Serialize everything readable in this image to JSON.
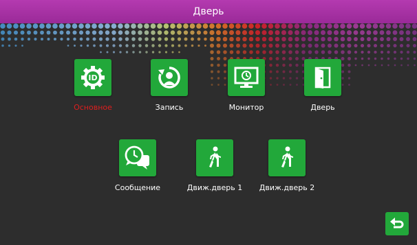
{
  "window": {
    "title": "Дверь"
  },
  "colors": {
    "accent": "#22a83a",
    "title_bar": "#a42fa2",
    "active_label": "#e01e1e",
    "background": "#2d2d2d"
  },
  "menu": {
    "items": [
      {
        "label": "Основное",
        "icon": "id-gear-icon",
        "active": true
      },
      {
        "label": "Запись",
        "icon": "record-person-icon",
        "active": false
      },
      {
        "label": "Монитор",
        "icon": "monitor-clock-icon",
        "active": false
      },
      {
        "label": "Дверь",
        "icon": "door-icon",
        "active": false
      },
      {
        "label": "Сообщение",
        "icon": "message-clock-icon",
        "active": false
      },
      {
        "label": "Движ.дверь 1",
        "icon": "walking-person-icon",
        "active": false
      },
      {
        "label": "Движ.дверь 2",
        "icon": "walking-person-icon",
        "active": false
      }
    ]
  },
  "back": {
    "icon": "back-arrow-icon"
  }
}
